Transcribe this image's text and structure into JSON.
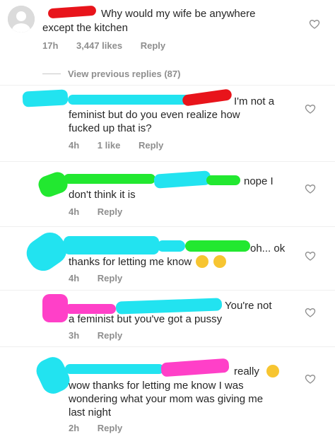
{
  "top_comment": {
    "text_line1": "Why would my wife be anywhere",
    "text_line2": "except the kitchen",
    "time": "17h",
    "likes": "3,447 likes",
    "reply": "Reply"
  },
  "view_previous": "View previous replies (87)",
  "replies": [
    {
      "line1": "I'm not a",
      "line2": "feminist but do you even realize how",
      "line3": "fucked up that is?",
      "time": "4h",
      "likes": "1 like",
      "reply": "Reply"
    },
    {
      "line1": "nope I",
      "line2": "don't think it is",
      "time": "4h",
      "reply": "Reply"
    },
    {
      "line1": "oh... ok",
      "line2": "thanks for letting me know",
      "time": "4h",
      "reply": "Reply"
    },
    {
      "line1": "You're not",
      "line2": "a feminist but you've got a pussy",
      "time": "3h",
      "reply": "Reply"
    },
    {
      "line1": "really",
      "line2": "wow thanks for letting me know I was",
      "line3": "wondering what your mom was giving me",
      "line4": "last night",
      "time": "2h",
      "reply": "Reply"
    }
  ],
  "colors": {
    "redact_red": "#e8141b",
    "redact_cyan": "#22e3f0",
    "redact_green": "#22e830",
    "redact_magenta": "#ff40c8",
    "muted": "#8e8e8e"
  }
}
